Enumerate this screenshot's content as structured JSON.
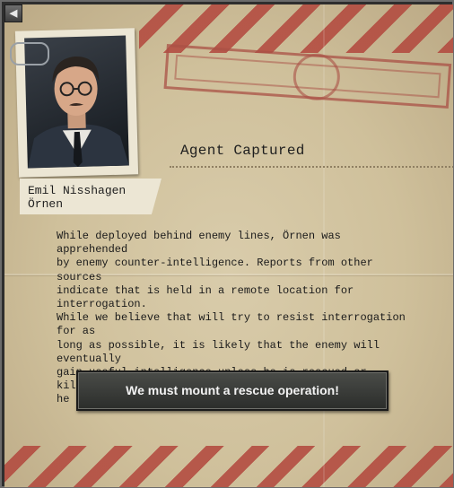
{
  "header": {
    "back_label": "◀"
  },
  "agent": {
    "name": "Emil Nisshagen",
    "codename": "Örnen"
  },
  "event": {
    "title": "Agent Captured",
    "body": "While deployed behind enemy lines, Örnen was apprehended\nby enemy counter-intelligence. Reports from other sources\nindicate that  is held in a remote location for interrogation.\nWhile we believe that  will try to resist interrogation for as\nlong as possible, it is likely that the enemy will eventually\ngain useful intelligence unless he is rescued or killed before\nhe breaks.",
    "option_label": "We must mount a rescue operation!"
  },
  "colors": {
    "paper": "#cfc09b",
    "stripe": "#b2463c",
    "button": "#3a3c3a"
  }
}
